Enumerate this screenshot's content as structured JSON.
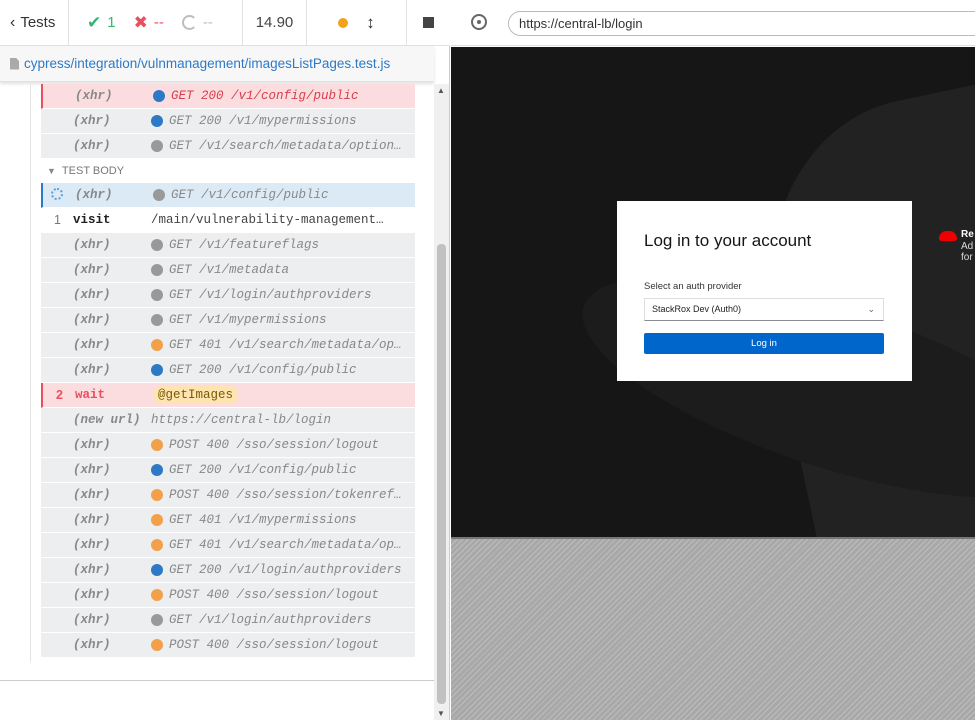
{
  "topbar": {
    "tests_label": "Tests",
    "passed": "1",
    "failed": "--",
    "pending": "--",
    "duration": "14.90"
  },
  "spec": {
    "path": "cypress/integration/vulnmanagement/imagesListPages.test.js"
  },
  "section_label": "TEST BODY",
  "hook_rows": [
    {
      "name": "(xhr)",
      "indicator": "blue",
      "msg": "GET 200 /v1/config/public",
      "style": "red"
    },
    {
      "name": "(xhr)",
      "indicator": "blue",
      "msg": "GET 200 /v1/mypermissions",
      "style": "grey"
    },
    {
      "name": "(xhr)",
      "indicator": "grey",
      "msg": "GET /v1/search/metadata/options?",
      "style": "grey"
    }
  ],
  "body_rows": [
    {
      "num": "",
      "name": "(xhr)",
      "indicator": "grey",
      "msg": "GET /v1/config/public",
      "style": "blue",
      "spinner": true
    },
    {
      "num": "1",
      "name": "visit",
      "indicator": "",
      "msg": "/main/vulnerability-management/ima…",
      "style": "white",
      "plain": true
    },
    {
      "num": "",
      "name": "(xhr)",
      "indicator": "grey",
      "msg": "GET /v1/featureflags",
      "style": "grey"
    },
    {
      "num": "",
      "name": "(xhr)",
      "indicator": "grey",
      "msg": "GET /v1/metadata",
      "style": "grey"
    },
    {
      "num": "",
      "name": "(xhr)",
      "indicator": "grey",
      "msg": "GET /v1/login/authproviders",
      "style": "grey"
    },
    {
      "num": "",
      "name": "(xhr)",
      "indicator": "grey",
      "msg": "GET /v1/mypermissions",
      "style": "grey"
    },
    {
      "num": "",
      "name": "(xhr)",
      "indicator": "orange",
      "msg": "GET 401 /v1/search/metadata/opt…",
      "style": "grey"
    },
    {
      "num": "",
      "name": "(xhr)",
      "indicator": "blue",
      "msg": "GET 200 /v1/config/public",
      "style": "grey"
    },
    {
      "num": "2",
      "name": "wait",
      "indicator": "",
      "msg": "@getImages",
      "style": "red",
      "plain": true,
      "alias": true
    },
    {
      "num": "",
      "name": "(new url)",
      "indicator": "",
      "msg": "https://central-lb/login",
      "style": "grey"
    },
    {
      "num": "",
      "name": "(xhr)",
      "indicator": "orange",
      "msg": "POST 400 /sso/session/logout",
      "style": "grey"
    },
    {
      "num": "",
      "name": "(xhr)",
      "indicator": "blue",
      "msg": "GET 200 /v1/config/public",
      "style": "grey"
    },
    {
      "num": "",
      "name": "(xhr)",
      "indicator": "orange",
      "msg": "POST 400 /sso/session/tokenrefr…",
      "style": "grey"
    },
    {
      "num": "",
      "name": "(xhr)",
      "indicator": "orange",
      "msg": "GET 401 /v1/mypermissions",
      "style": "grey"
    },
    {
      "num": "",
      "name": "(xhr)",
      "indicator": "orange",
      "msg": "GET 401 /v1/search/metadata/opt…",
      "style": "grey"
    },
    {
      "num": "",
      "name": "(xhr)",
      "indicator": "blue",
      "msg": "GET 200 /v1/login/authproviders",
      "style": "grey"
    },
    {
      "num": "",
      "name": "(xhr)",
      "indicator": "orange",
      "msg": "POST 400 /sso/session/logout",
      "style": "grey"
    },
    {
      "num": "",
      "name": "(xhr)",
      "indicator": "grey",
      "msg": "GET /v1/login/authproviders",
      "style": "grey"
    },
    {
      "num": "",
      "name": "(xhr)",
      "indicator": "orange",
      "msg": "POST 400 /sso/session/logout",
      "style": "grey"
    }
  ],
  "aut": {
    "url": "https://central-lb/login",
    "login": {
      "title": "Log in to your account",
      "provider_label": "Select an auth provider",
      "provider_value": "StackRox Dev (Auth0)",
      "button": "Log in"
    },
    "brand": {
      "line1": "Re",
      "line2": "Ad",
      "line3": "for"
    }
  },
  "colors": {
    "pass": "#3cb371",
    "fail": "#e94f5f",
    "link": "#2e79c6",
    "login_button": "#0066cc"
  }
}
